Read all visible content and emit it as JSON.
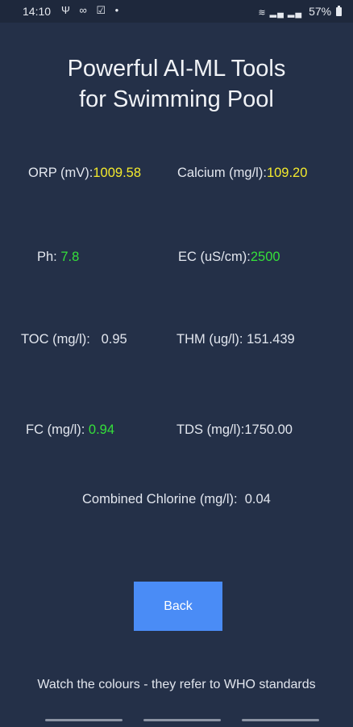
{
  "status_bar": {
    "time": "14:10",
    "left_icons": [
      "usb-icon",
      "voicemail-icon",
      "check-icon",
      "dot-icon"
    ],
    "left_icons_glyphs": "Ψ ∞ ☑ •",
    "battery": "57%",
    "signal_glyphs": "≋ ▂▄ ▂▄"
  },
  "header": {
    "title_line1": "Powerful AI-ML Tools",
    "title_line2": "for Swimming Pool"
  },
  "metrics": {
    "orp": {
      "label": "ORP (mV):",
      "value": "1009.58",
      "color": "#f4ea2c"
    },
    "calcium": {
      "label": "Calcium (mg/l):",
      "value": "109.20",
      "color": "#f4ea2c"
    },
    "ph": {
      "label": "Ph: ",
      "value": "7.8",
      "color": "#35e03a"
    },
    "ec": {
      "label": "EC (uS/cm):",
      "value": "2500",
      "color": "#35e03a"
    },
    "toc": {
      "label": "TOC (mg/l):   ",
      "value": "0.95",
      "color": "#e2e6ee"
    },
    "thm": {
      "label": "THM (ug/l): ",
      "value": "151.439",
      "color": "#e2e6ee"
    },
    "fc": {
      "label": "FC (mg/l): ",
      "value": "0.94",
      "color": "#35e03a"
    },
    "tds": {
      "label": "TDS (mg/l):",
      "value": "1750.00",
      "color": "#e2e6ee"
    },
    "combined_chlorine": {
      "label": "Combined Chlorine (mg/l):  ",
      "value": "0.04",
      "color": "#e2e6ee"
    }
  },
  "actions": {
    "back_label": "Back"
  },
  "footer": {
    "note": "Watch the colours - they refer to WHO standards"
  },
  "colors": {
    "background": "#243048",
    "accent": "#4a8cf6",
    "warning": "#f4ea2c",
    "good": "#35e03a"
  }
}
